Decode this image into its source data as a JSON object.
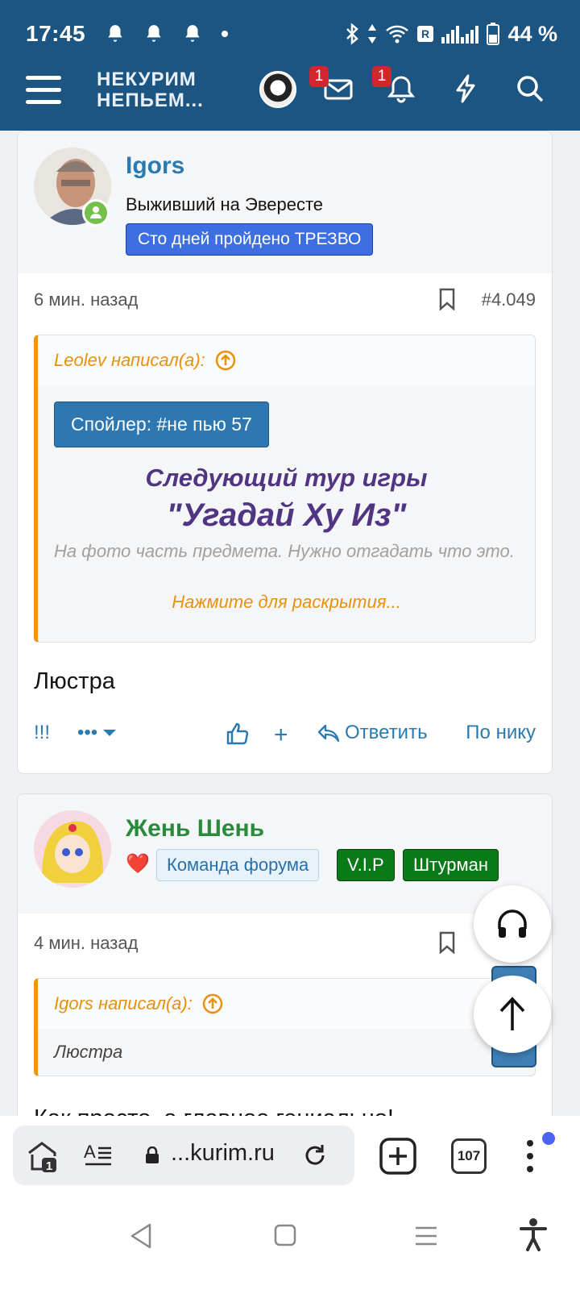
{
  "status_bar": {
    "time": "17:45",
    "battery": "44 %"
  },
  "header": {
    "logo_line1": "НЕКУРИМ",
    "logo_line2": "НЕПЬЕМ...",
    "messages_badge": "1",
    "alerts_badge": "1"
  },
  "post1": {
    "username": "Igors",
    "user_title": "Выживший на Эвересте",
    "banner": "Сто дней пройдено ТРЕЗВО",
    "time": "6 мин. назад",
    "post_number": "#4.049",
    "quote": {
      "author": "Leolev написал(а):",
      "spoiler_label": "Спойлер: #не пью 57",
      "game_line1": "Следующий тур игры",
      "game_line2": "\"Угадай Ху Из\"",
      "description": "На фото часть предмета. Нужно отгадать что это.",
      "expand_label": "Нажмите для раскрытия..."
    },
    "text": "Люстра",
    "actions": {
      "exclaim": "!!!",
      "more": "•••",
      "plus": "+",
      "reply": "Ответить",
      "by_nick": "По нику"
    }
  },
  "post2": {
    "username": "Жень Шень",
    "heart": "❤️",
    "tags": [
      "Команда форума",
      "V.I.P",
      "Штурман"
    ],
    "time": "4 мин. назад",
    "quote": {
      "author": "Igors написал(а):",
      "body": "Люстра"
    },
    "text_partial": "Как просто, а главное гениально!"
  },
  "browser": {
    "url": "...kurim.ru",
    "tab_count": "107",
    "home_badge": "1"
  },
  "colors": {
    "header_bg": "#1c5581",
    "link_blue": "#2a7ab0",
    "quote_orange": "#f0960e",
    "game_purple": "#503582",
    "team_green": "#0a7a19"
  }
}
